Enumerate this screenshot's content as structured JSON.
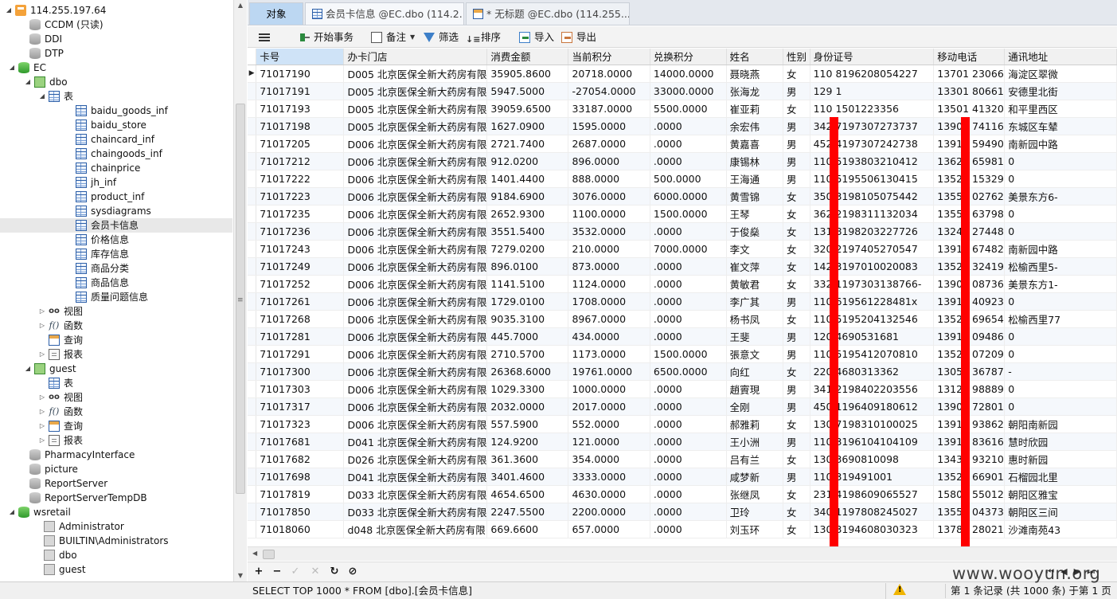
{
  "tree": {
    "server": "114.255.197.64",
    "items": [
      {
        "label": "CCDM (只读)",
        "icon": "db-gray"
      },
      {
        "label": "DDI",
        "icon": "db-gray"
      },
      {
        "label": "DTP",
        "icon": "db-gray"
      },
      {
        "label": "EC",
        "icon": "db-green"
      },
      {
        "label": "dbo",
        "icon": "schema"
      },
      {
        "label": "表",
        "icon": "table"
      },
      {
        "label": "baidu_goods_inf",
        "icon": "table"
      },
      {
        "label": "baidu_store",
        "icon": "table"
      },
      {
        "label": "chaincard_inf",
        "icon": "table"
      },
      {
        "label": "chaingoods_inf",
        "icon": "table"
      },
      {
        "label": "chainprice",
        "icon": "table"
      },
      {
        "label": "jh_inf",
        "icon": "table"
      },
      {
        "label": "product_inf",
        "icon": "table"
      },
      {
        "label": "sysdiagrams",
        "icon": "table"
      },
      {
        "label": "会员卡信息",
        "icon": "table"
      },
      {
        "label": "价格信息",
        "icon": "table"
      },
      {
        "label": "库存信息",
        "icon": "table"
      },
      {
        "label": "商品分类",
        "icon": "table"
      },
      {
        "label": "商品信息",
        "icon": "table"
      },
      {
        "label": "质量问题信息",
        "icon": "table"
      },
      {
        "label": "视图",
        "icon": "view"
      },
      {
        "label": "函数",
        "icon": "func"
      },
      {
        "label": "查询",
        "icon": "query"
      },
      {
        "label": "报表",
        "icon": "report"
      },
      {
        "label": "guest",
        "icon": "schema"
      },
      {
        "label": "表",
        "icon": "table"
      },
      {
        "label": "视图",
        "icon": "view"
      },
      {
        "label": "函数",
        "icon": "func"
      },
      {
        "label": "查询",
        "icon": "query"
      },
      {
        "label": "报表",
        "icon": "report"
      },
      {
        "label": "PharmacyInterface",
        "icon": "db-gray"
      },
      {
        "label": "picture",
        "icon": "db-gray"
      },
      {
        "label": "ReportServer",
        "icon": "db-gray"
      },
      {
        "label": "ReportServerTempDB",
        "icon": "db-gray"
      },
      {
        "label": "wsretail",
        "icon": "db-green"
      },
      {
        "label": "Administrator",
        "icon": "schema-gray"
      },
      {
        "label": "BUILTIN\\Administrators",
        "icon": "schema-gray"
      },
      {
        "label": "dbo",
        "icon": "schema-gray"
      },
      {
        "label": "guest",
        "icon": "schema-gray"
      }
    ],
    "view_icon_glyph": "oo",
    "func_icon_glyph": "f()"
  },
  "tabs": {
    "objects": "对象",
    "table_tab": "会员卡信息 @EC.dbo (114.2...",
    "query_tab": "* 无标题 @EC.dbo (114.255...."
  },
  "toolbar": {
    "begin_transaction": "开始事务",
    "memo": "备注",
    "filter": "筛选",
    "sort": "排序",
    "import": "导入",
    "export": "导出"
  },
  "grid": {
    "columns": [
      "卡号",
      "办卡门店",
      "消费金额",
      "当前积分",
      "兑换积分",
      "姓名",
      "性别",
      "身份证号",
      "移动电话",
      "通讯地址"
    ],
    "rows": [
      [
        "71017190",
        "D005 北京医保全新大药房有限",
        "35905.8600",
        "20718.0000",
        "14000.0000",
        "聂晓燕",
        "女",
        "110     8196208054227",
        "13701     23066",
        "海淀区翠微"
      ],
      [
        "71017191",
        "D005 北京医保全新大药房有限",
        "5947.5000",
        "-27054.0000",
        "33000.0000",
        "张海龙",
        "男",
        "129     1",
        "13301     80661",
        "安德里北街"
      ],
      [
        "71017193",
        "D005 北京医保全新大药房有限",
        "39059.6500",
        "33187.0000",
        "5500.0000",
        "崔亚莉",
        "女",
        "110     1501223356",
        "13501     41320",
        "和平里西区"
      ],
      [
        "71017198",
        "D005 北京医保全新大药房有限",
        "1627.0900",
        "1595.0000",
        ".0000",
        "余宏伟",
        "男",
        "342     7197307273737",
        "13901     74116",
        "东城区车辇"
      ],
      [
        "71017205",
        "D006 北京医保全新大药房有限",
        "2721.7400",
        "2687.0000",
        ".0000",
        "黄嘉喜",
        "男",
        "452     4197307242738",
        "13910     59490",
        "南新园中路"
      ],
      [
        "71017212",
        "D006 北京医保全新大药房有限",
        "912.0200",
        "896.0000",
        ".0000",
        "康锡林",
        "男",
        "110     5193803210412",
        "13621     65981",
        "0"
      ],
      [
        "71017222",
        "D006 北京医保全新大药房有限",
        "1401.4400",
        "888.0000",
        "500.0000",
        "王海通",
        "男",
        "110     5195506130415",
        "13520     15329",
        "0"
      ],
      [
        "71017223",
        "D006 北京医保全新大药房有限",
        "9184.6900",
        "3076.0000",
        "6000.0000",
        "黄雪锦",
        "女",
        "350     3198105075442",
        "13552     02762",
        "美景东方6-"
      ],
      [
        "71017235",
        "D006 北京医保全新大药房有限",
        "2652.9300",
        "1100.0000",
        "1500.0000",
        "王琴",
        "女",
        "362     2198311132034",
        "13552     63798",
        "0"
      ],
      [
        "71017236",
        "D006 北京医保全新大药房有限",
        "3551.5400",
        "3532.0000",
        ".0000",
        "于俊燊",
        "女",
        "131     8198203227726",
        "13241     27448",
        "0"
      ],
      [
        "71017243",
        "D006 北京医保全新大药房有限",
        "7279.0200",
        "210.0000",
        "7000.0000",
        "李文",
        "女",
        "320     2197405270547",
        "13910     67482",
        "南新园中路"
      ],
      [
        "71017249",
        "D006 北京医保全新大药房有限",
        "896.0100",
        "873.0000",
        ".0000",
        "崔文萍",
        "女",
        "142     3197010020083",
        "13520     32419",
        "松榆西里5-"
      ],
      [
        "71017252",
        "D006 北京医保全新大药房有限",
        "1141.5100",
        "1124.0000",
        ".0000",
        "黄敏君",
        "女",
        "332     1197303138766-",
        "13901     08736",
        "美景东方1-"
      ],
      [
        "71017261",
        "D006 北京医保全新大药房有限",
        "1729.0100",
        "1708.0000",
        ".0000",
        "李广其",
        "男",
        "110     619561228481x",
        "13910     40923",
        "0"
      ],
      [
        "71017268",
        "D006 北京医保全新大药房有限",
        "9035.3100",
        "8967.0000",
        ".0000",
        "杨书凤",
        "女",
        "110     5195204132546",
        "13521     69654",
        "松榆西里77"
      ],
      [
        "71017281",
        "D006 北京医保全新大药房有限",
        "445.7000",
        "434.0000",
        ".0000",
        "王斐",
        "男",
        "120     4690531681",
        "13911     09486",
        "0"
      ],
      [
        "71017291",
        "D006 北京医保全新大药房有限",
        "2710.5700",
        "1173.0000",
        "1500.0000",
        "張意文",
        "男",
        "110     5195412070810",
        "13521     07209",
        "0"
      ],
      [
        "71017300",
        "D006 北京医保全新大药房有限",
        "26368.6000",
        "19761.0000",
        "6500.0000",
        "向红",
        "女",
        "220     4680313362",
        "13051     36787",
        "-"
      ],
      [
        "71017303",
        "D006 北京医保全新大药房有限",
        "1029.3300",
        "1000.0000",
        ".0000",
        "趙賨現",
        "男",
        "341     2198402203556",
        "13120     98889",
        "0"
      ],
      [
        "71017317",
        "D006 北京医保全新大药房有限",
        "2032.0000",
        "2017.0000",
        ".0000",
        "全刚",
        "男",
        "450     1196409180612",
        "13901     72801",
        "0"
      ],
      [
        "71017323",
        "D006 北京医保全新大药房有限",
        "557.5900",
        "552.0000",
        ".0000",
        "郝雅莉",
        "女",
        "130     7198310100025",
        "13911     93862",
        "朝阳南新园"
      ],
      [
        "71017681",
        "D041 北京医保全新大药房有限",
        "124.9200",
        "121.0000",
        ".0000",
        "王小洲",
        "男",
        "110     3196104104109",
        "13910     83616",
        "慧时欣园"
      ],
      [
        "71017682",
        "D026 北京医保全新大药房有限",
        "361.3600",
        "354.0000",
        ".0000",
        "吕有兰",
        "女",
        "130     3690810098",
        "13439     93210",
        "惠时新园"
      ],
      [
        "71017698",
        "D041 北京医保全新大药房有限",
        "3401.4600",
        "3333.0000",
        ".0000",
        "咸梦新",
        "男",
        "110     319491001",
        "13522     66901",
        "石榴园北里"
      ],
      [
        "71017819",
        "D033 北京医保全新大药房有限",
        "4654.6500",
        "4630.0000",
        ".0000",
        "张继凤",
        "女",
        "231     4198609065527",
        "15801     55012",
        "朝阳区雅宝"
      ],
      [
        "71017850",
        "D033 北京医保全新大药房有限",
        "2247.5500",
        "2200.0000",
        ".0000",
        "卫玲",
        "女",
        "340     1197808245027",
        "13552     04373",
        "朝阳区三间"
      ],
      [
        "71018060",
        "d048 北京医保全新大药房有限",
        "669.6600",
        "657.0000",
        ".0000",
        "刘玉环",
        "女",
        "130     3194608030323",
        "13789     28021",
        "沙滩南苑43"
      ]
    ],
    "current_row_marker": "▶"
  },
  "navbar": {
    "add": "+",
    "remove": "−",
    "apply": "✓",
    "discard": "✕",
    "refresh": "↻",
    "stop": "⊘"
  },
  "status": {
    "sql": "SELECT TOP 1000  * FROM [dbo].[会员卡信息]",
    "record": "第 1 条记录 (共 1000 条) 于第 1 页"
  },
  "watermark": "www.wooyun.org",
  "colors": {
    "redaction": "#ff0000",
    "active_tab": "#bcd7f2",
    "header_first_col": "#cfe3f7"
  }
}
